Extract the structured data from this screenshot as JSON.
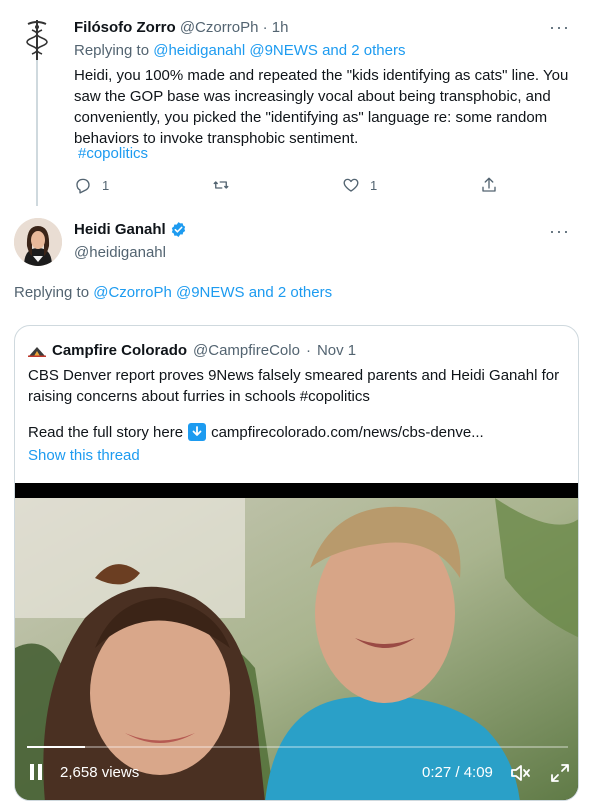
{
  "tweet1": {
    "author_name": "Filósofo Zorro",
    "author_handle": "@CzorroPh",
    "separator": "·",
    "time": "1h",
    "more": "···",
    "replying_label": "Replying to",
    "replying_targets": "@heidiganahl @9NEWS and 2 others",
    "text": "Heidi, you 100% made and repeated the \"kids identifying as cats\" line. You saw the GOP base was increasingly vocal about being transphobic, and conveniently, you picked the \"identifying as\" language re: some random behaviors to invoke transphobic sentiment.",
    "hashtag": "#copolitics",
    "replies": "1",
    "retweets": "",
    "likes": "1",
    "icons": {
      "reply": "reply-icon",
      "retweet": "retweet-icon",
      "like": "heart-icon",
      "share": "share-icon"
    }
  },
  "tweet2": {
    "author_name": "Heidi Ganahl",
    "author_handle": "@heidiganahl",
    "more": "···",
    "verified_icon": "verified-badge-icon",
    "replying_label": "Replying to",
    "replying_targets": "@CzorroPh @9NEWS and 2 others"
  },
  "quote": {
    "author_name": "Campfire Colorado",
    "author_handle": "@CampfireColo",
    "separator": "·",
    "date": "Nov 1",
    "text": "CBS Denver report proves 9News falsely smeared parents and Heidi Ganahl for raising concerns about furries in schools #copolitics",
    "read_label": "Read the full story here",
    "read_link": "campfirecolorado.com/news/cbs-denve...",
    "show_thread": "Show this thread"
  },
  "video": {
    "views": "2,658 views",
    "time": "0:27 / 4:09",
    "progress": 0.108
  },
  "colors": {
    "link": "#1d9bf0",
    "muted": "#536471",
    "text": "#0f1419",
    "border": "#cfd9de"
  }
}
